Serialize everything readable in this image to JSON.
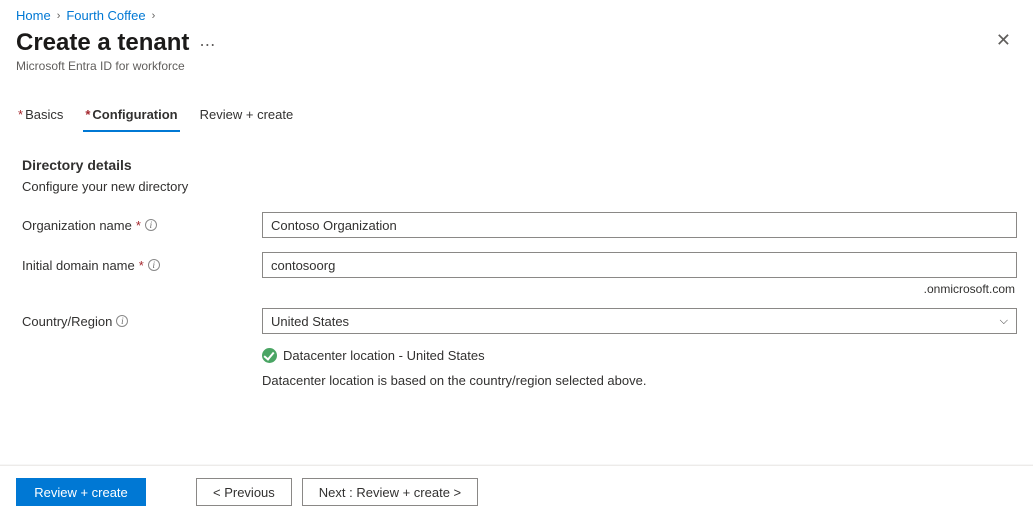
{
  "breadcrumb": {
    "home": "Home",
    "parent": "Fourth Coffee"
  },
  "title": "Create a tenant",
  "subtitle": "Microsoft Entra ID for workforce",
  "tabs": {
    "basics": "Basics",
    "configuration": "Configuration",
    "review": "Review + create"
  },
  "section": {
    "heading": "Directory details",
    "description": "Configure your new directory"
  },
  "form": {
    "org_label": "Organization name",
    "org_value": "Contoso Organization",
    "domain_label": "Initial domain name",
    "domain_value": "contosoorg",
    "domain_suffix": ".onmicrosoft.com",
    "country_label": "Country/Region",
    "country_value": "United States",
    "datacenter_label": "Datacenter location - United States",
    "datacenter_note": "Datacenter location is based on the country/region selected above."
  },
  "footer": {
    "review_create": "Review + create",
    "previous": "< Previous",
    "next": "Next : Review + create >"
  }
}
